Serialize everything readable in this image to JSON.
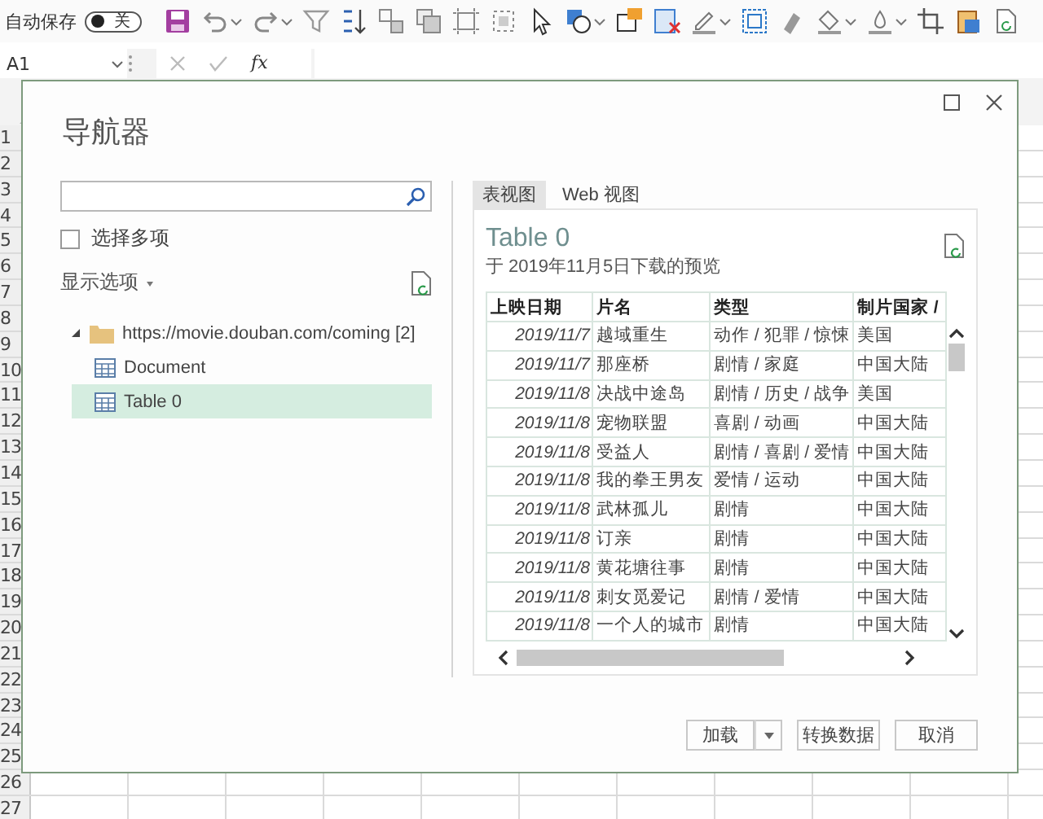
{
  "toolbar": {
    "autosave_label": "自动保存",
    "autosave_toggle": {
      "label": "关",
      "on": false
    }
  },
  "formula_bar": {
    "name_box": "A1",
    "function_button": "fx"
  },
  "sheet": {
    "row_headers": [
      "1",
      "2",
      "3",
      "4",
      "5",
      "6",
      "7",
      "8",
      "9",
      "10",
      "11",
      "12",
      "13",
      "14",
      "15",
      "16",
      "17",
      "18",
      "19",
      "20",
      "21",
      "22",
      "23",
      "24",
      "25",
      "26",
      "27"
    ]
  },
  "dialog": {
    "title": "导航器",
    "select_multiple": {
      "label": "选择多项",
      "checked": false
    },
    "display_options": "显示选项",
    "tree": [
      {
        "label": "https://movie.douban.com/coming [2]",
        "kind": "folder",
        "expanded": true,
        "selected": false,
        "children": [
          {
            "label": "Document",
            "kind": "table",
            "selected": false
          },
          {
            "label": "Table 0",
            "kind": "table",
            "selected": true
          }
        ]
      }
    ],
    "tabs": [
      {
        "label": "表视图",
        "selected": true
      },
      {
        "label": "Web 视图",
        "selected": false
      }
    ],
    "preview": {
      "title": "Table 0",
      "subtitle": "于 2019年11月5日下载的预览",
      "columns": [
        "上映日期",
        "片名",
        "类型",
        "制片国家 /"
      ],
      "rows": [
        [
          "2019/11/7",
          "越域重生",
          "动作 / 犯罪 / 惊悚",
          "美国"
        ],
        [
          "2019/11/7",
          "那座桥",
          "剧情 / 家庭",
          "中国大陆"
        ],
        [
          "2019/11/8",
          "决战中途岛",
          "剧情 / 历史 / 战争",
          "美国"
        ],
        [
          "2019/11/8",
          "宠物联盟",
          "喜剧 / 动画",
          "中国大陆"
        ],
        [
          "2019/11/8",
          "受益人",
          "剧情 / 喜剧 / 爱情",
          "中国大陆"
        ],
        [
          "2019/11/8",
          "我的拳王男友",
          "爱情 / 运动",
          "中国大陆"
        ],
        [
          "2019/11/8",
          "武林孤儿",
          "剧情",
          "中国大陆"
        ],
        [
          "2019/11/8",
          "订亲",
          "剧情",
          "中国大陆"
        ],
        [
          "2019/11/8",
          "黄花塘往事",
          "剧情",
          "中国大陆"
        ],
        [
          "2019/11/8",
          "刺女觅爱记",
          "剧情 / 爱情",
          "中国大陆"
        ],
        [
          "2019/11/8",
          "一个人的城市",
          "剧情",
          "中国大陆"
        ]
      ]
    },
    "buttons": [
      {
        "label": "加载",
        "kind": "split"
      },
      {
        "label": "转换数据",
        "kind": "plain"
      },
      {
        "label": "取消",
        "kind": "plain"
      }
    ]
  }
}
